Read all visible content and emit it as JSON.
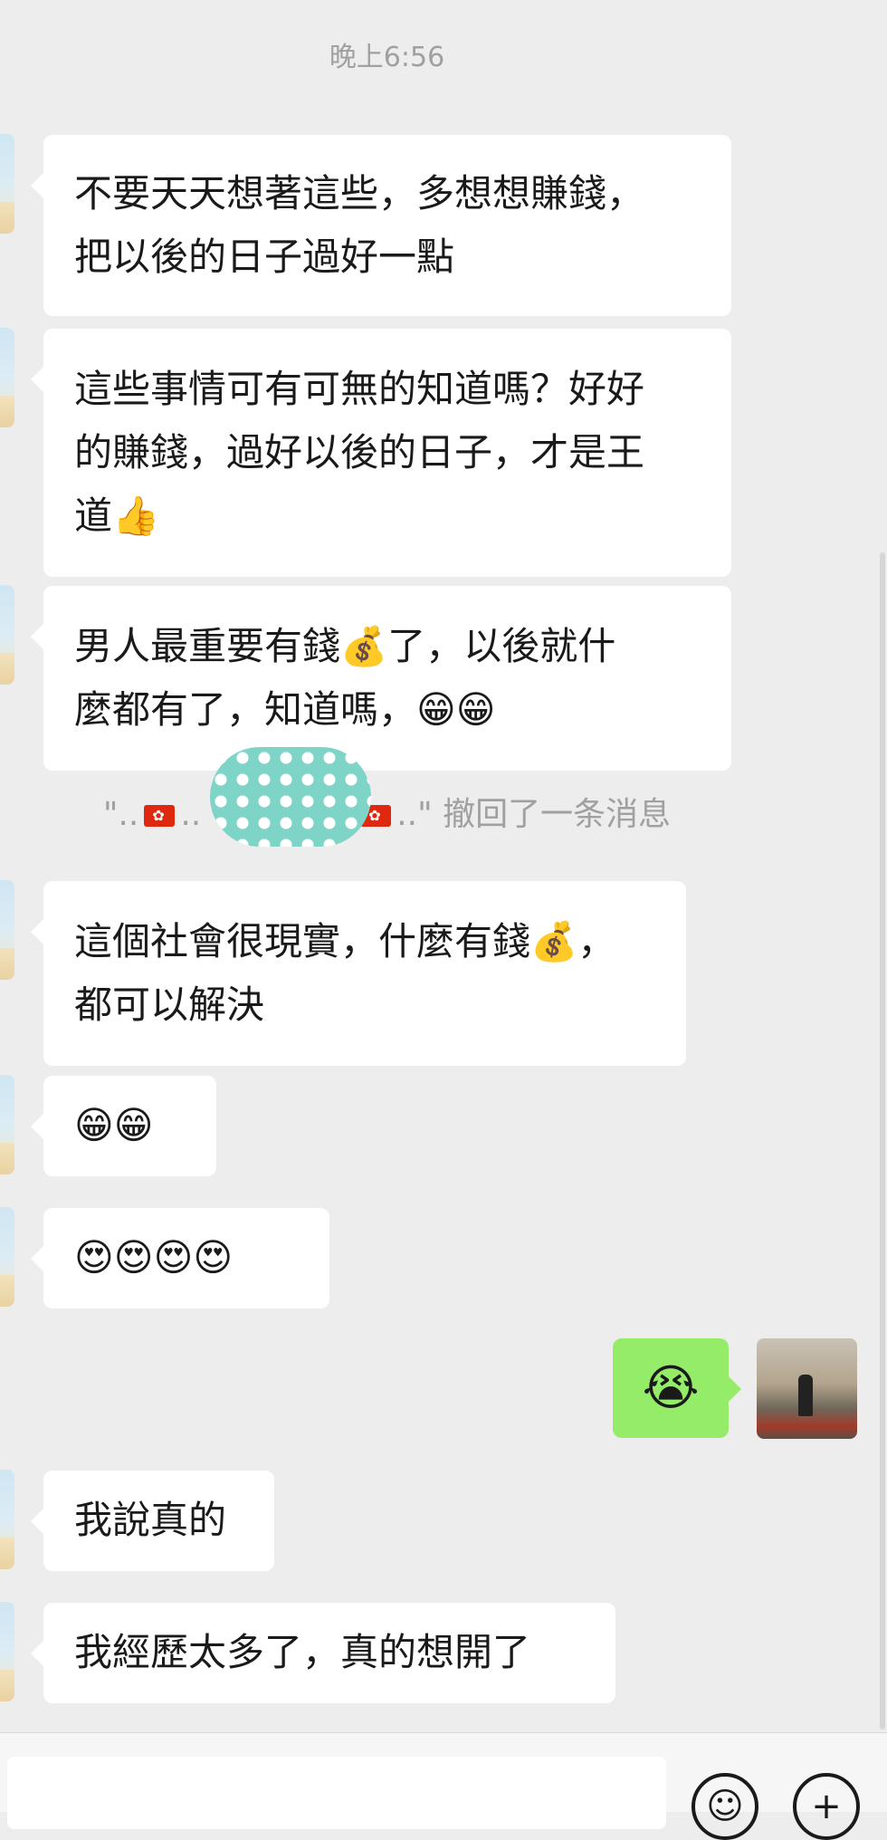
{
  "timestamp": "晚上6:56",
  "messages_left_1": {
    "line1": "不要天天想著這些，多想想賺錢，",
    "line2": "把以後的日子過好一點"
  },
  "messages_left_2": {
    "line1": "這些事情可有可無的知道嗎？好好",
    "line2": "的賺錢，過好以後的日子，才是王",
    "line3": "道👍"
  },
  "messages_left_3": {
    "line1": "男人最重要有錢💰了，以後就什",
    "line2": "麼都有了，知道嗎，😁😁"
  },
  "recall_notice": {
    "prefix": "\"..",
    "middle": "..",
    "suffix": "..\" 撤回了一条消息"
  },
  "messages_left_4": {
    "line1": "這個社會很現實，什麼有錢💰，",
    "line2": "都可以解決"
  },
  "messages_left_5": {
    "text": "😁😁"
  },
  "messages_left_6": {
    "text": "😍😍😍😍"
  },
  "message_right_1": {
    "text": "😭"
  },
  "messages_left_7": {
    "text": "我說真的"
  },
  "messages_left_8": {
    "text": "我經歷太多了，真的想開了"
  },
  "input_bar": {
    "emoji_icon": "☺",
    "plus_icon": "+"
  },
  "colors": {
    "background": "#ededed",
    "received_bubble": "#ffffff",
    "sent_bubble": "#95ec69"
  }
}
